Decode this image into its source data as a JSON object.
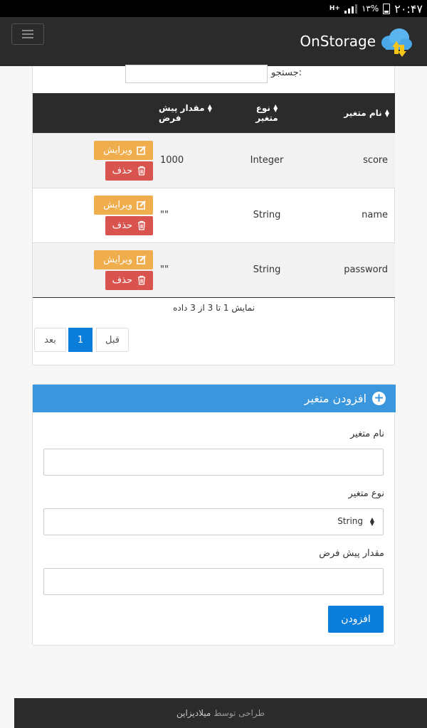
{
  "status_bar": {
    "clock": "۲۰:۴۷",
    "battery_pct": "۱۳%",
    "network": "H+"
  },
  "navbar": {
    "brand": "OnStorage",
    "menu_icon": "hamburger-icon",
    "logo_icon": "cloud-upload-icon"
  },
  "table_section": {
    "search_label": "جستجو:",
    "search_value": "",
    "columns": {
      "name": "نام متغیر",
      "type_line1": "نوع",
      "type_line2": "متغیر",
      "default": "مقدار پیش فرض"
    },
    "rows": [
      {
        "name": "score",
        "type": "Integer",
        "default": "1000",
        "edit": "ویرایش",
        "delete": "حذف"
      },
      {
        "name": "name",
        "type": "String",
        "default": "\"\"",
        "edit": "ویرایش",
        "delete": "حذف"
      },
      {
        "name": "password",
        "type": "String",
        "default": "\"\"",
        "edit": "ویرایش",
        "delete": "حذف"
      }
    ],
    "info": "نمایش 1 تا 3 از 3 داده",
    "pagination": {
      "next": "بعد",
      "current": "1",
      "prev": "قبل"
    }
  },
  "add_form": {
    "title": "افزودن متغیر",
    "name_label": "نام متغیر",
    "name_value": "",
    "type_label": "نوع متغیر",
    "type_value": "String",
    "default_label": "مقدار پیش فرض",
    "default_value": "",
    "submit": "افزودن"
  },
  "footer": {
    "prefix": "طراحی توسط",
    "author": "میلادیزاین"
  },
  "colors": {
    "edit": "#f0ad4e",
    "delete": "#d9534f",
    "primary": "#0b7dda",
    "header_blue": "#3a96dd",
    "dark": "#2b2b2b"
  }
}
